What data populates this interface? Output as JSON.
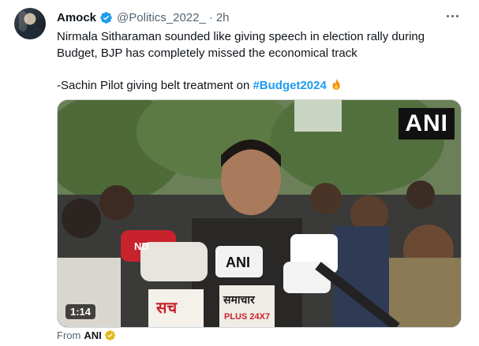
{
  "tweet": {
    "author_name": "Amock",
    "handle": "@Politics_2022_",
    "separator": "·",
    "time": "2h",
    "line1": "Nirmala Sitharaman sounded like giving speech in election rally during Budget, BJP has completely missed the economical track",
    "line2_prefix": "-Sachin Pilot giving belt treatment on ",
    "hashtag": "#Budget2024",
    "verified_icon": "verified-badge-icon",
    "more_icon": "more-options-icon"
  },
  "media": {
    "logo_text": "ANI",
    "duration": "1:14",
    "mic_labels": {
      "ani_mic": "ANI",
      "sach": "सच",
      "samachar": "समाचार",
      "plus": "PLUS 24X7",
      "nd": "ND"
    }
  },
  "source": {
    "prefix": "From",
    "name": "ANI"
  },
  "colors": {
    "link": "#1d9bf0",
    "verified": "#1d9bf0",
    "secondary_text": "#536471"
  }
}
